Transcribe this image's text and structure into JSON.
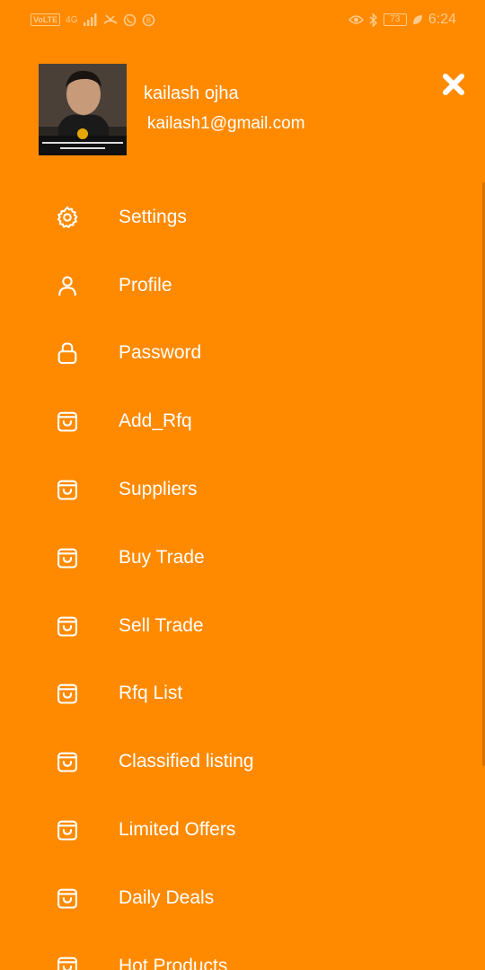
{
  "status_bar": {
    "network_badge": "VoLTE",
    "network_type": "4G",
    "battery_level": "73",
    "time": "6:24"
  },
  "profile": {
    "name": "kailash ojha",
    "email": "kailash1@gmail.com"
  },
  "menu": {
    "items": [
      {
        "label": "Settings",
        "icon": "gear-icon"
      },
      {
        "label": "Profile",
        "icon": "person-icon"
      },
      {
        "label": "Password",
        "icon": "lock-icon"
      },
      {
        "label": "Add_Rfq",
        "icon": "shopping-bag-icon"
      },
      {
        "label": "Suppliers",
        "icon": "shopping-bag-icon"
      },
      {
        "label": "Buy Trade",
        "icon": "shopping-bag-icon"
      },
      {
        "label": "Sell Trade",
        "icon": "shopping-bag-icon"
      },
      {
        "label": "Rfq List",
        "icon": "shopping-bag-icon"
      },
      {
        "label": "Classified listing",
        "icon": "shopping-bag-icon"
      },
      {
        "label": "Limited Offers",
        "icon": "shopping-bag-icon"
      },
      {
        "label": "Daily Deals",
        "icon": "shopping-bag-icon"
      },
      {
        "label": "Hot Products",
        "icon": "shopping-bag-icon"
      }
    ]
  },
  "colors": {
    "background": "#FF8A00",
    "text": "#FFFFFF"
  }
}
